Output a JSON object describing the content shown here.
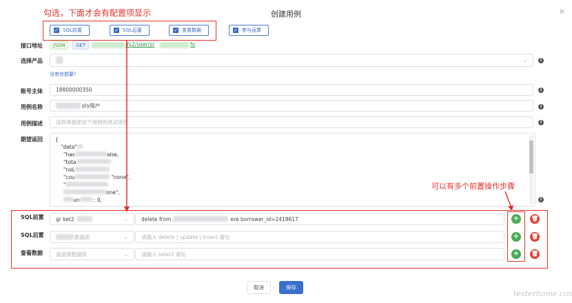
{
  "dialog": {
    "title": "创建用例",
    "close_icon": "×"
  },
  "annotations": {
    "top_note": "勾选，下面才会有配置项显示",
    "right_note": "可以有多个前置操作步骤",
    "color": "#e0312b"
  },
  "options": [
    {
      "label": "SQL前置",
      "checked": true
    },
    {
      "label": "SQL后置",
      "checked": true
    },
    {
      "label": "查看数据",
      "checked": true
    },
    {
      "label": "参与运算",
      "checked": true
    }
  ],
  "form": {
    "api_address": {
      "label": "接口地址",
      "tag_json": "JSON",
      "tag_get": "GET",
      "url_visible": "i/v2/user/sr",
      "url_tail": "fo"
    },
    "product": {
      "label": "选择产品",
      "hint_link": "没有你想要?"
    },
    "account": {
      "label": "账号主体",
      "value": "18800000350"
    },
    "case_name": {
      "label": "用例名称",
      "value_visible": "ply用户"
    },
    "case_desc": {
      "label": "用例描述",
      "placeholder": "请具体描述这个用例的测试场景"
    },
    "expected": {
      "label": "期望返回",
      "lines": [
        "{",
        "\"data\":",
        "\"has",
        "alse,",
        "\"tota",
        "\"noL",
        "\"cou",
        "\"none\",",
        "one\",",
        "\"",
        "un",
        ": 0,"
      ]
    }
  },
  "sql_rows": [
    {
      "label": "SQL前置",
      "db_value": "gr   ket2",
      "sql_value_left": "delete from",
      "sql_value_right": "ere borrower_id=2418617",
      "db_placeholder": "",
      "sql_placeholder": ""
    },
    {
      "label": "SQL后置",
      "db_value": "",
      "db_placeholder": "数据库",
      "sql_value_left": "",
      "sql_value_right": "",
      "sql_placeholder": "请输入 delete | update | insert 语句"
    },
    {
      "label": "查看数据",
      "db_value": "",
      "db_placeholder": "请选择数据库",
      "sql_value_left": "",
      "sql_value_right": "",
      "sql_placeholder": "请输入 select 语句"
    }
  ],
  "footer": {
    "cancel": "取消",
    "save": "保存",
    "primary_color": "#3a6fcc"
  },
  "watermark": "testerhome.com"
}
